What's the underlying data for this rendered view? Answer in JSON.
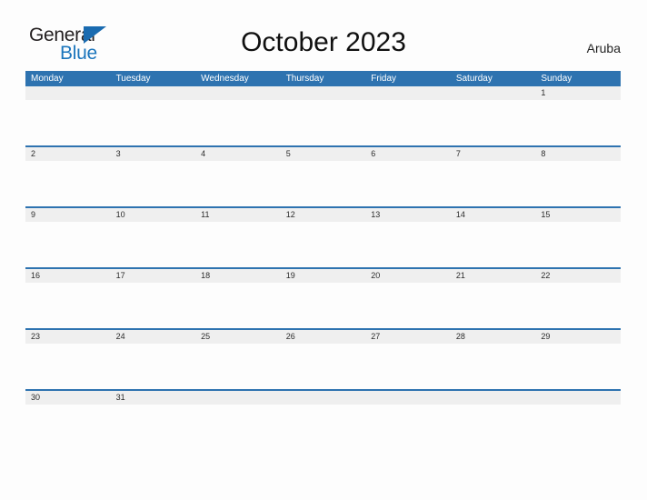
{
  "brand": {
    "name_part1": "General",
    "name_part2": "Blue",
    "triangle_color": "#1A6BB0",
    "blue_color": "#1B75BC"
  },
  "header": {
    "title": "October 2023",
    "region": "Aruba"
  },
  "theme": {
    "header_blue": "#2E73B0",
    "row_separator_blue": "#2E73B0",
    "date_strip_gray": "#EFEFEF",
    "page_background": "#FDFDFD",
    "date_text": "#2B2B2B",
    "weekday_text": "#FFFFFF"
  },
  "calendar": {
    "month": "October",
    "year": "2023",
    "weekday_headers": [
      "Monday",
      "Tuesday",
      "Wednesday",
      "Thursday",
      "Friday",
      "Saturday",
      "Sunday"
    ],
    "weeks": [
      {
        "days": [
          "",
          "",
          "",
          "",
          "",
          "",
          "1"
        ]
      },
      {
        "days": [
          "2",
          "3",
          "4",
          "5",
          "6",
          "7",
          "8"
        ]
      },
      {
        "days": [
          "9",
          "10",
          "11",
          "12",
          "13",
          "14",
          "15"
        ]
      },
      {
        "days": [
          "16",
          "17",
          "18",
          "19",
          "20",
          "21",
          "22"
        ]
      },
      {
        "days": [
          "23",
          "24",
          "25",
          "26",
          "27",
          "28",
          "29"
        ]
      },
      {
        "days": [
          "30",
          "31",
          "",
          "",
          "",
          "",
          ""
        ]
      }
    ]
  }
}
